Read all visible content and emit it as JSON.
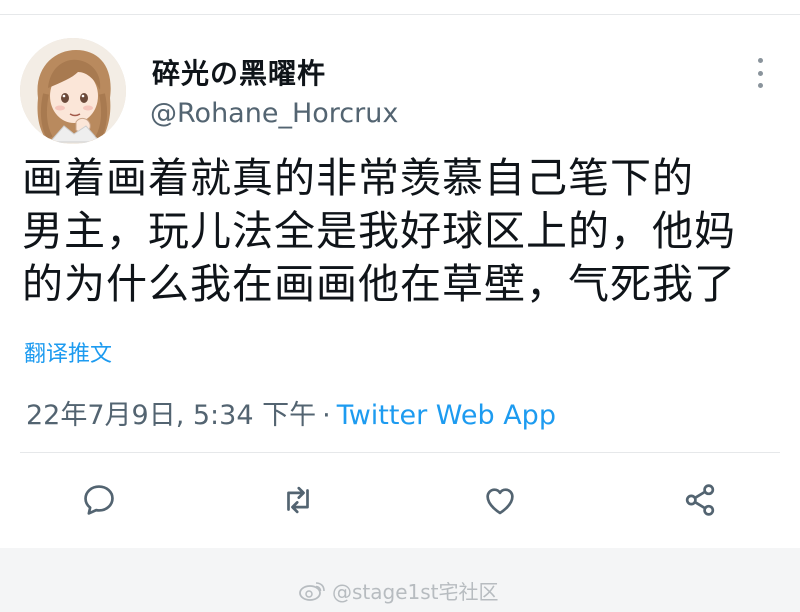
{
  "tweet": {
    "display_name": "碎光の黑曜杵",
    "handle": "@Rohane_Horcrux",
    "text_lines": [
      "画着画着就真的非常羡慕自己笔下的",
      "男主，玩儿法全是我好球区上的，他妈",
      "的为什么我在画画他在草壁，气死我了"
    ],
    "translate_label": "翻译推文",
    "timestamp": "22年7月9日, 5:34 下午",
    "separator": "·",
    "source": "Twitter Web App"
  },
  "actions": [
    {
      "icon": "reply-icon"
    },
    {
      "icon": "retweet-icon"
    },
    {
      "icon": "like-icon"
    },
    {
      "icon": "share-icon"
    }
  ],
  "watermark": {
    "text": "@stage1st宅社区",
    "icon": "weibo-logo"
  },
  "colors": {
    "accent": "#1d9bf0",
    "secondary_text": "#536471",
    "icon_gray": "#536471"
  }
}
